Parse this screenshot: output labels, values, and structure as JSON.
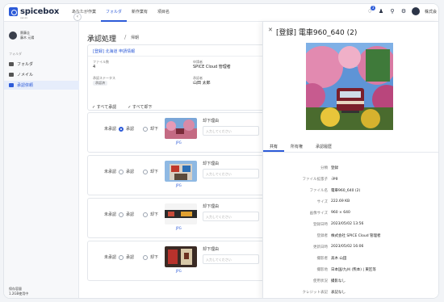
{
  "app": {
    "logo_text": "spicebox",
    "logo_sub": "ver.xx",
    "nav": [
      "あなたが作業",
      "フォルダ",
      "新作業有",
      "項目名"
    ],
    "notifications_count": "3",
    "user_label": "株式会"
  },
  "sidebar": {
    "user_name": "齋藤圭",
    "user_sub": "藤木 元陽",
    "section_label": "フォルダ",
    "items": [
      {
        "label": "フォルダ"
      },
      {
        "label": "ノメイル"
      },
      {
        "label": "承認依頼"
      }
    ],
    "storage_label": "保存容量",
    "storage_value": "1.2GB使用中"
  },
  "main": {
    "title": "承認処理",
    "breadcrumb_sep": "/",
    "subtitle": "帰朝",
    "card_title": "[登録] 北海道  申請情報",
    "file_count_label": "ファイル数",
    "file_count": "4",
    "applicant_label": "申請者",
    "applicant": "SPICE Cloud 管理者",
    "status_label": "承認ステータス",
    "status_value": "承認済",
    "approver_label": "承認者",
    "approver": "山田 太郎",
    "bulk_approve": "すべて承認",
    "bulk_reject": "すべて却下",
    "rows": [
      {
        "pending": "未承認",
        "approve": "承認",
        "reject": "却下",
        "reason_label": "却下理由",
        "placeholder": "入力してください",
        "thumb_label": "JPG"
      },
      {
        "pending": "未承認",
        "approve": "承認",
        "reject": "却下",
        "reason_label": "却下理由",
        "placeholder": "入力してください",
        "thumb_label": "JPG"
      },
      {
        "pending": "未承認",
        "approve": "承認",
        "reject": "却下",
        "reason_label": "却下理由",
        "placeholder": "入力してください",
        "thumb_label": "JPG"
      },
      {
        "pending": "未承認",
        "approve": "承認",
        "reject": "却下",
        "reason_label": "却下理由",
        "placeholder": "入力してください",
        "thumb_label": "JPG"
      }
    ]
  },
  "panel": {
    "title": "[登録] 電車960_640 (2)",
    "tabs": [
      "共有",
      "所有権",
      "承認履歴"
    ],
    "details": [
      {
        "key": "分類",
        "val": "登録"
      },
      {
        "key": "ファイル拡張子",
        "val": ".jpg"
      },
      {
        "key": "ファイル名",
        "val": "電車960_640 (2)"
      },
      {
        "key": "サイズ",
        "val": "222.69 KB"
      },
      {
        "key": "画像サイズ",
        "val": "960 × 640"
      },
      {
        "key": "登録日時",
        "val": "2023/05/02 13:56"
      },
      {
        "key": "登録者",
        "val": "株式会社 SPICE Cloud 管理者"
      },
      {
        "key": "更新日時",
        "val": "2023/05/02 16:06"
      },
      {
        "key": "撮影者",
        "val": "高木 山田"
      },
      {
        "key": "撮影地",
        "val": "日本国/九州 (熊本) | 東区等"
      },
      {
        "key": "使用状況",
        "val": "撮影なし"
      },
      {
        "key": "クレジット表記",
        "val": "表記なし"
      }
    ]
  },
  "colors": {
    "accent": "#2d5bd8",
    "text": "#222222"
  }
}
